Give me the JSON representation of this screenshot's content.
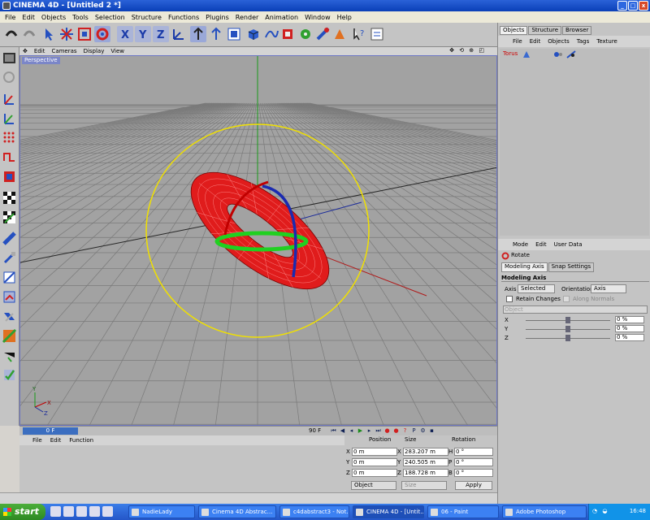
{
  "window": {
    "title": "CINEMA 4D - [Untitled 2 *]",
    "min": "_",
    "max": "□",
    "close": "x"
  },
  "menu": [
    "File",
    "Edit",
    "Objects",
    "Tools",
    "Selection",
    "Structure",
    "Functions",
    "Plugins",
    "Render",
    "Animation",
    "Window",
    "Help"
  ],
  "viewport": {
    "menu": [
      "Edit",
      "Cameras",
      "Display",
      "View"
    ],
    "nav_icons": "✥ ⟲ ⊕ ◰",
    "label": "Perspective"
  },
  "axis_gizmo": {
    "y": "Y",
    "x": "X",
    "z": "Z"
  },
  "timeline": {
    "current": "0 F",
    "end": "90 F",
    "controls": [
      "⏮",
      "◀",
      "◂",
      "▶",
      "▸",
      "⏭",
      "●",
      "●",
      "?",
      "P",
      "⚙",
      "▪"
    ]
  },
  "material_manager": {
    "menu": [
      "File",
      "Edit",
      "Function"
    ]
  },
  "coords": {
    "headers": {
      "position": "Position",
      "size": "Size",
      "rotation": "Rotation"
    },
    "rows": [
      {
        "pl": "X",
        "pv": "0 m",
        "sl": "X",
        "sv": "283.207 m",
        "rl": "H",
        "rv": "0 °"
      },
      {
        "pl": "Y",
        "pv": "0 m",
        "sl": "Y",
        "sv": "240.505 m",
        "rl": "P",
        "rv": "0 °"
      },
      {
        "pl": "Z",
        "pv": "0 m",
        "sl": "Z",
        "sv": "188.728 m",
        "rl": "B",
        "rv": "0 °"
      }
    ],
    "mode": "Object",
    "size_mode": "Size",
    "apply": "Apply"
  },
  "objects_panel": {
    "tabs": [
      "Objects",
      "Structure",
      "Browser"
    ],
    "menu": [
      "File",
      "Edit",
      "Objects",
      "Tags",
      "Texture"
    ],
    "items": [
      {
        "name": "Torus"
      }
    ]
  },
  "attributes": {
    "menu": [
      "Mode",
      "Edit",
      "User Data"
    ],
    "tool": "Rotate",
    "tabs": [
      "Modeling Axis",
      "Snap Settings"
    ],
    "section": "Modeling Axis",
    "axis_label": "Axis",
    "axis_value": "Selected",
    "orientation_label": "Orientation",
    "orientation_value": "Axis",
    "retain": "Retain Changes",
    "along": "Along Normals",
    "object_placeholder": "Object",
    "sliders": [
      {
        "label": "X",
        "value": "0 %",
        "level": 0.5
      },
      {
        "label": "Y",
        "value": "0 %",
        "level": 0.5
      },
      {
        "label": "Z",
        "value": "0 %",
        "level": 0.5
      }
    ]
  },
  "taskbar": {
    "start": "start",
    "tasks": [
      "NadieLady",
      "Cinema 4D Abstrac...",
      "c4dabstract3 - Not...",
      "CINEMA 4D - [Untit...",
      "06 - Paint",
      "Adobe Photoshop"
    ],
    "active": 3,
    "clock": "16:48"
  },
  "colors": {
    "viewport_bg": "#a2a2a2",
    "torus": "#e01c1c",
    "rotate_ring": "#f0e000"
  }
}
